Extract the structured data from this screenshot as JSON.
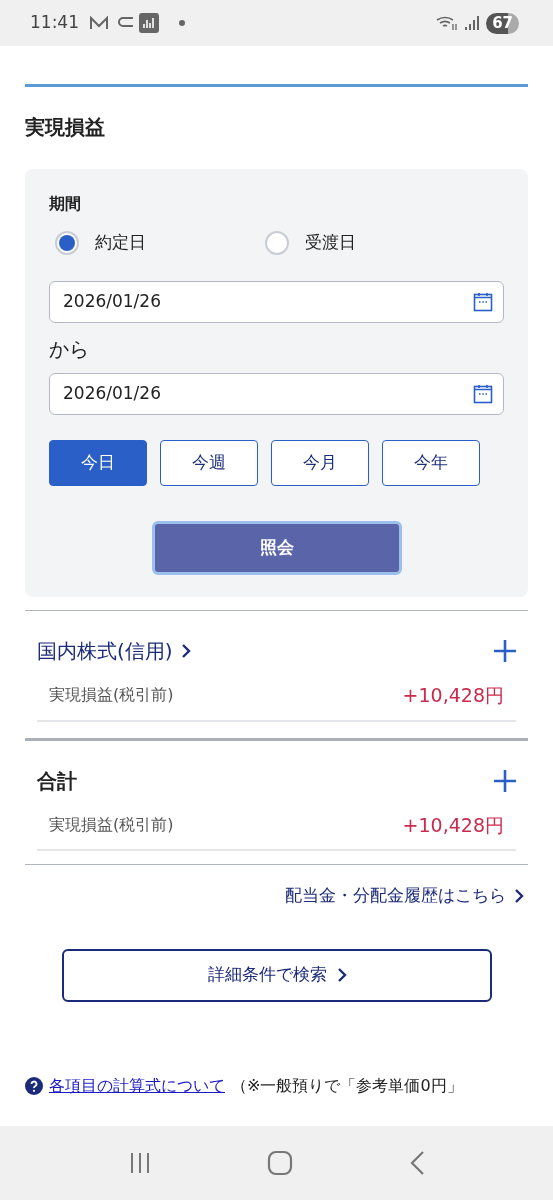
{
  "status_bar": {
    "time": "11:41",
    "battery": "67"
  },
  "title": "実現損益",
  "period": {
    "label": "期間",
    "options": [
      {
        "label": "約定日",
        "selected": true
      },
      {
        "label": "受渡日",
        "selected": false
      }
    ],
    "from_date": "2026/01/26",
    "separator": "から",
    "to_date": "2026/01/26"
  },
  "quick_buttons": [
    {
      "label": "今日",
      "selected": true
    },
    {
      "label": "今週",
      "selected": false
    },
    {
      "label": "今月",
      "selected": false
    },
    {
      "label": "今年",
      "selected": false
    }
  ],
  "submit_button": "照会",
  "sections": [
    {
      "title": "国内株式(信用)",
      "kind": "link",
      "rows": [
        {
          "label": "実現損益(税引前)",
          "value": "+10,428円"
        }
      ]
    },
    {
      "title": "合計",
      "kind": "plain",
      "rows": [
        {
          "label": "実現損益(税引前)",
          "value": "+10,428円"
        }
      ]
    }
  ],
  "dividend_link": "配当金・分配金履歴はこちら",
  "search_button": "詳細条件で検索",
  "help_note": {
    "link": "各項目の計算式について",
    "text": "（※一般預りで「参考単価0円」"
  }
}
